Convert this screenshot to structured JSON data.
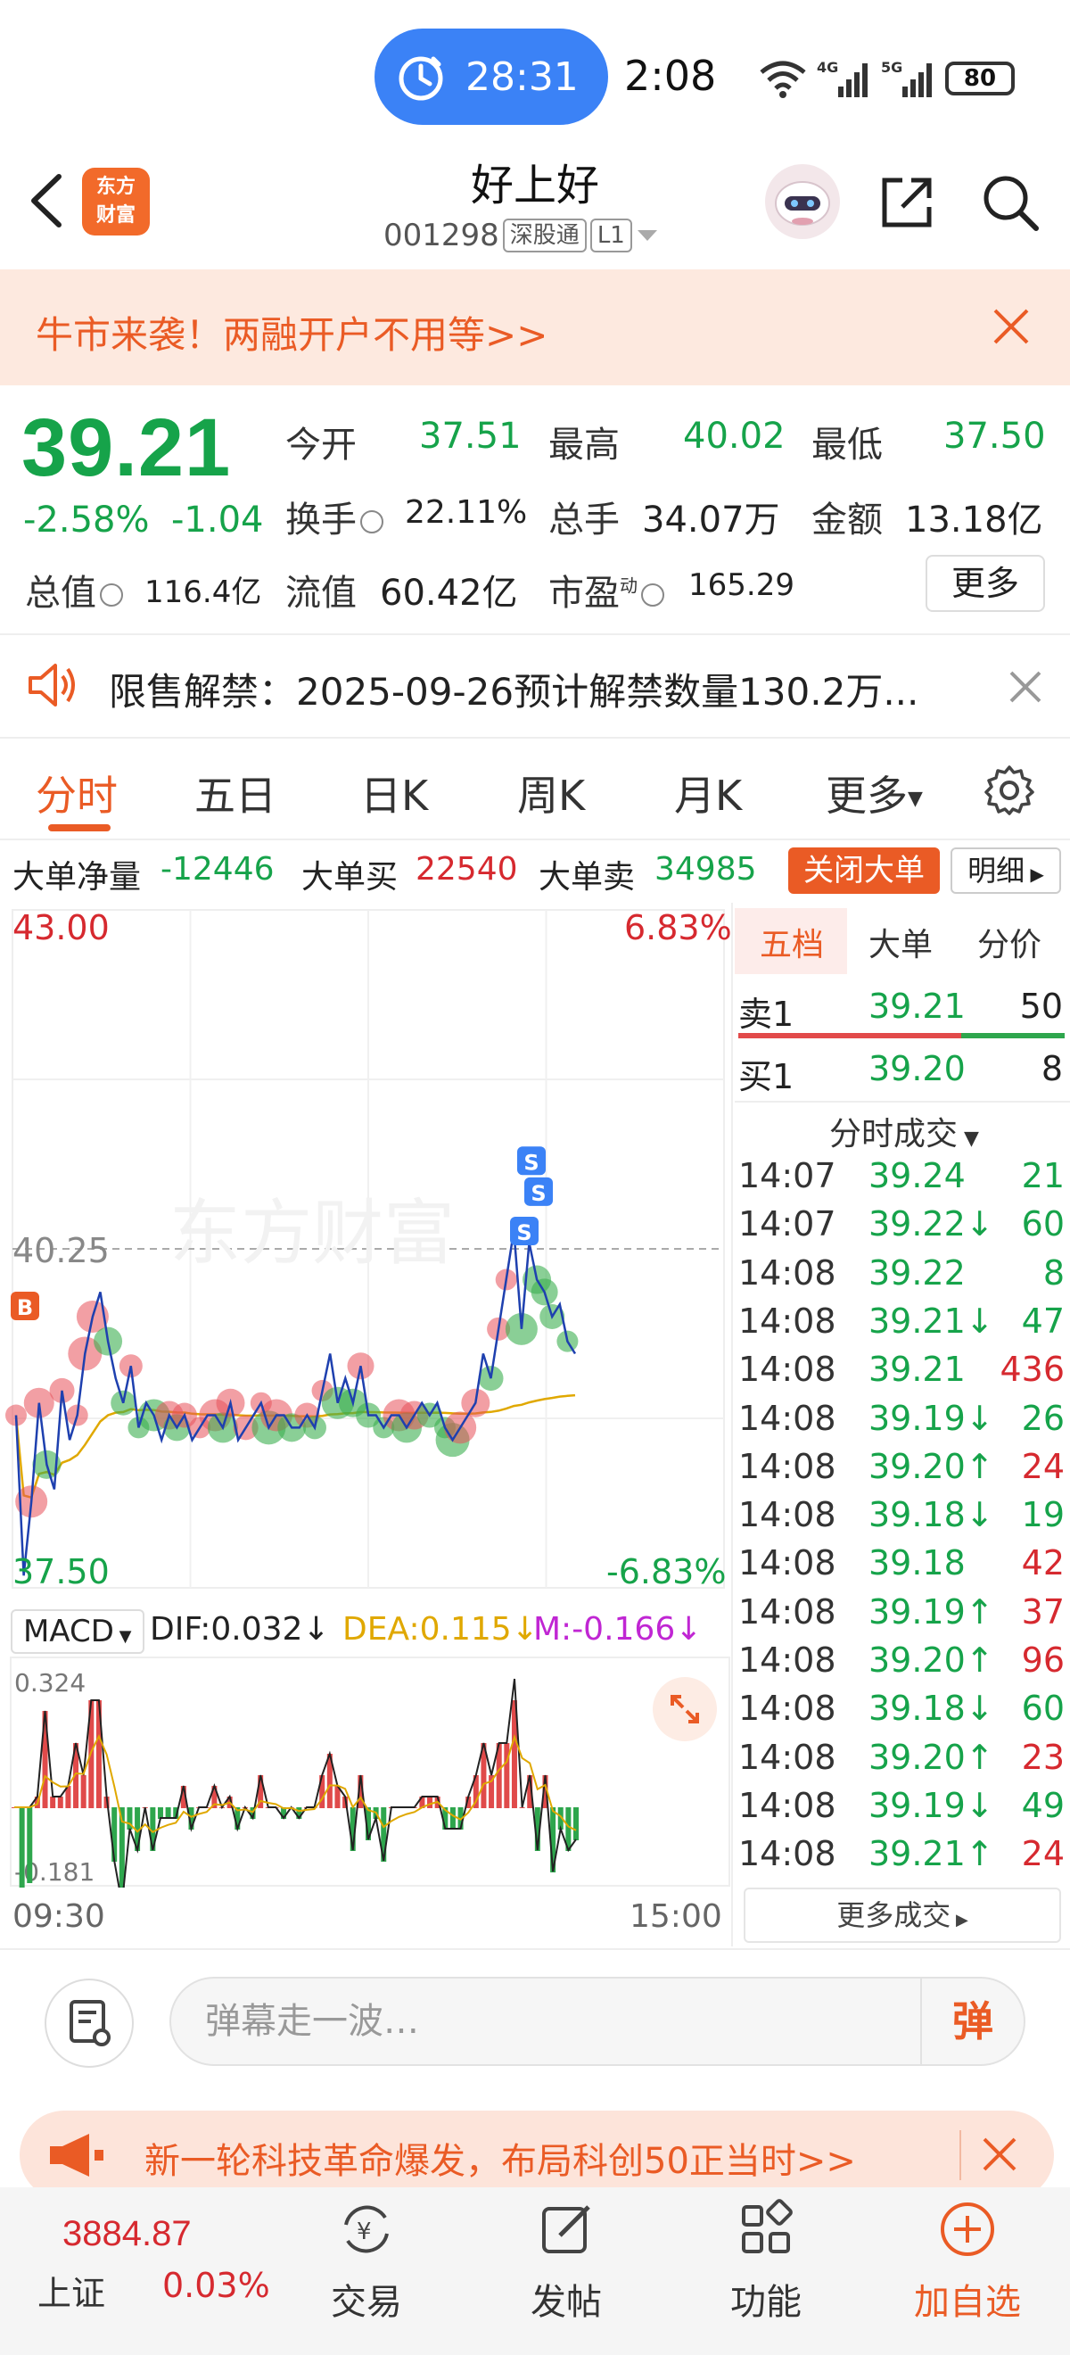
{
  "status_bar": {
    "timer": "28:31",
    "clock": "2:08",
    "battery": "80",
    "network": [
      "6",
      "4G",
      "5G"
    ]
  },
  "header": {
    "logo_line1": "东方",
    "logo_line2": "财富",
    "stock_name": "好上好",
    "stock_code": "001298",
    "tag_connect": "深股通",
    "tag_level": "L1"
  },
  "promo": {
    "text": "牛市来袭！两融开户不用等>>"
  },
  "quote": {
    "price": "39.21",
    "change_pct": "-2.58%",
    "change_amt": "-1.04",
    "open_label": "今开",
    "open": "37.51",
    "high_label": "最高",
    "high": "40.02",
    "low_label": "最低",
    "low": "37.50",
    "turnover_label": "换手",
    "turnover": "22.11%",
    "volume_label": "总手",
    "volume": "34.07万",
    "amount_label": "金额",
    "amount": "13.18亿",
    "mktcap_label": "总值",
    "mktcap": "116.4亿",
    "float_label": "流值",
    "float": "60.42亿",
    "pe_label": "市盈",
    "pe_sup": "动",
    "pe": "165.29",
    "more_label": "更多"
  },
  "notice": {
    "text": "限售解禁：2025-09-26预计解禁数量130.2万..."
  },
  "tabs": [
    "分时",
    "五日",
    "日K",
    "周K",
    "月K",
    "更多"
  ],
  "big_orders": {
    "net_label": "大单净量",
    "net": "-12446",
    "buy_label": "大单买",
    "buy": "22540",
    "sell_label": "大单卖",
    "sell": "34985",
    "close_label": "关闭大单",
    "detail_label": "明细"
  },
  "chart_labels": {
    "price_high": "43.00",
    "price_mid": "40.25",
    "price_low": "37.50",
    "pct_high": "6.83%",
    "pct_low": "-6.83%",
    "watermark": "东方财富",
    "time_start": "09:30",
    "time_end": "15:00",
    "macd_label": "MACD",
    "dif": "DIF:0.032↓",
    "dea": "DEA:0.115↓",
    "m": "M:-0.166↓",
    "macd_high": "0.324",
    "macd_low": "-0.181"
  },
  "chart_data": {
    "type": "line",
    "yrange": [
      37.5,
      43.0
    ],
    "reference_price": 40.25,
    "x_start": "09:30",
    "x_end": "15:00",
    "series": [
      {
        "values": [
          38.9,
          37.6,
          38.2,
          39.0,
          38.5,
          38.3,
          39.1,
          38.7,
          38.9,
          39.4,
          39.7,
          39.9,
          39.5,
          39.2,
          39.0,
          39.3,
          38.8,
          39.0,
          38.9,
          38.7,
          38.9,
          38.8,
          38.9,
          38.7,
          38.8,
          38.9,
          38.9,
          38.8,
          39.0,
          38.7,
          38.8,
          38.9,
          39.0,
          38.8,
          38.9,
          38.9,
          38.8,
          38.8,
          38.9,
          38.8,
          39.1,
          39.4,
          39.0,
          39.2,
          39.0,
          39.3,
          38.9,
          38.9,
          38.8,
          38.9,
          38.9,
          38.8,
          38.9,
          39.0,
          38.9,
          39.0,
          38.8,
          38.7,
          38.8,
          38.9,
          39.0,
          39.4,
          39.2,
          39.6,
          40.0,
          40.4,
          39.6,
          40.3,
          40.0,
          39.9,
          39.7,
          39.8,
          39.5,
          39.4
        ]
      }
    ],
    "marker_labels": [
      "B",
      "S",
      "S",
      "S"
    ]
  },
  "orderbook": {
    "tabs": [
      "五档",
      "大单",
      "分价"
    ],
    "sell1": {
      "label": "卖1",
      "price": "39.21",
      "vol": "50"
    },
    "buy1": {
      "label": "买1",
      "price": "39.20",
      "vol": "8"
    },
    "trades_title": "分时成交",
    "trades": [
      {
        "t": "14:07",
        "p": "39.24",
        "v": "21",
        "vc": "green"
      },
      {
        "t": "14:07",
        "p": "39.22↓",
        "v": "60",
        "vc": "green"
      },
      {
        "t": "14:08",
        "p": "39.22",
        "v": "8",
        "vc": "green"
      },
      {
        "t": "14:08",
        "p": "39.21↓",
        "v": "47",
        "vc": "green"
      },
      {
        "t": "14:08",
        "p": "39.21",
        "v": "436",
        "vc": "red"
      },
      {
        "t": "14:08",
        "p": "39.19↓",
        "v": "26",
        "vc": "green"
      },
      {
        "t": "14:08",
        "p": "39.20↑",
        "v": "24",
        "vc": "red"
      },
      {
        "t": "14:08",
        "p": "39.18↓",
        "v": "19",
        "vc": "green"
      },
      {
        "t": "14:08",
        "p": "39.18",
        "v": "42",
        "vc": "red"
      },
      {
        "t": "14:08",
        "p": "39.19↑",
        "v": "37",
        "vc": "red"
      },
      {
        "t": "14:08",
        "p": "39.20↑",
        "v": "96",
        "vc": "red"
      },
      {
        "t": "14:08",
        "p": "39.18↓",
        "v": "60",
        "vc": "green"
      },
      {
        "t": "14:08",
        "p": "39.20↑",
        "v": "23",
        "vc": "red"
      },
      {
        "t": "14:08",
        "p": "39.19↓",
        "v": "49",
        "vc": "green"
      },
      {
        "t": "14:08",
        "p": "39.21↑",
        "v": "24",
        "vc": "red"
      }
    ],
    "more_label": "更多成交"
  },
  "comment": {
    "placeholder": "弹幕走一波…",
    "danmu_label": "弹"
  },
  "ad": {
    "text": "新一轮科技革命爆发，布局科创50正当时>>"
  },
  "bottom_nav": {
    "index_value": "3884.87",
    "index_name": "上证",
    "index_change": "0.03%",
    "items": [
      "交易",
      "发帖",
      "功能",
      "加自选"
    ]
  },
  "colors": {
    "up": "#d6292f",
    "down": "#16a34a",
    "accent": "#ea5b25",
    "line": "#1e40af",
    "avg_line": "#e0a800"
  }
}
